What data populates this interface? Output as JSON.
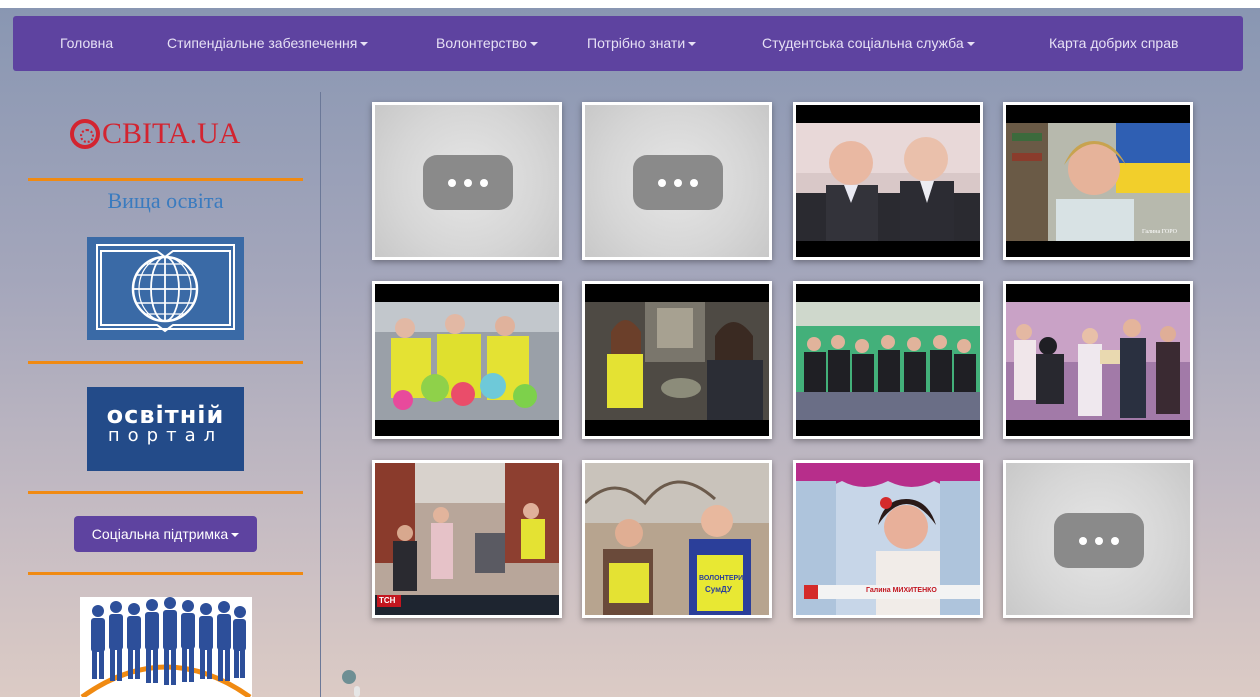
{
  "nav": {
    "items": [
      {
        "label": "Головна",
        "dropdown": false
      },
      {
        "label": "Стипендіальне забезпечення",
        "dropdown": true
      },
      {
        "label": "Волонтерство",
        "dropdown": true
      },
      {
        "label": "Потрібно знати",
        "dropdown": true
      },
      {
        "label": "Студентська соціальна служба",
        "dropdown": true
      },
      {
        "label": "Карта добрих справ",
        "dropdown": false
      }
    ]
  },
  "sidebar": {
    "osvita_logo_text": "CBITA.UA",
    "vyshcha_text": "Вища освіта",
    "portal_line1": "освітній",
    "portal_line2": "портал",
    "social_button_label": "Соціальна підтримка"
  },
  "colors": {
    "nav_bg": "#5e43a0",
    "accent_orange": "#f08a12",
    "osvita_red": "#d32430",
    "vyshcha_blue": "#3a7bbf"
  },
  "gallery": {
    "thumbs": [
      {
        "kind": "placeholder"
      },
      {
        "kind": "placeholder"
      },
      {
        "kind": "video",
        "scene": "two-boys"
      },
      {
        "kind": "video",
        "scene": "woman-flag"
      },
      {
        "kind": "video",
        "scene": "balloons"
      },
      {
        "kind": "video",
        "scene": "hallway"
      },
      {
        "kind": "video",
        "scene": "audience"
      },
      {
        "kind": "video",
        "scene": "stage-award"
      },
      {
        "kind": "video",
        "scene": "street-crowd"
      },
      {
        "kind": "video",
        "scene": "volunteers-outdoor"
      },
      {
        "kind": "video",
        "scene": "woman-curtain"
      },
      {
        "kind": "placeholder"
      }
    ],
    "thumb_texts": {
      "woman_flag_caption": "Галина ГОРО",
      "tsn_logo": "ТСН",
      "vest_text_1": "ВОЛОНТЕРИ",
      "vest_text_2": "СумДУ",
      "lower_third_name": "Галина МИХИТЕНКО"
    }
  }
}
